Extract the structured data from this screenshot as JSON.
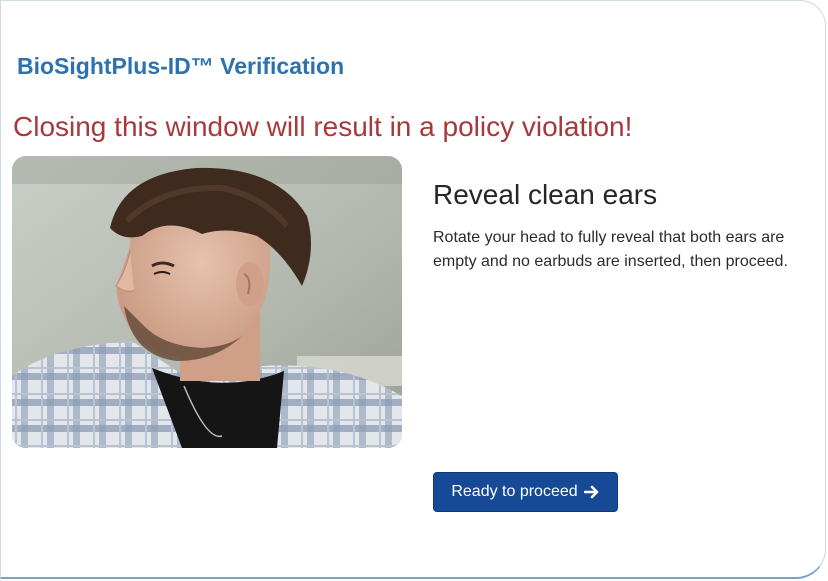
{
  "header": {
    "title": "BioSightPlus-ID™ Verification"
  },
  "warning": {
    "text": "Closing this window will result in a policy violation!"
  },
  "instruction": {
    "title": "Reveal clean ears",
    "body": "Rotate your head to fully reveal that both ears are empty and no earbuds are inserted, then proceed."
  },
  "actions": {
    "proceed_label": "Ready to proceed",
    "proceed_icon": "arrow-right-icon"
  },
  "colors": {
    "title": "#2d72b0",
    "warning": "#a8383a",
    "button": "#174a96"
  }
}
